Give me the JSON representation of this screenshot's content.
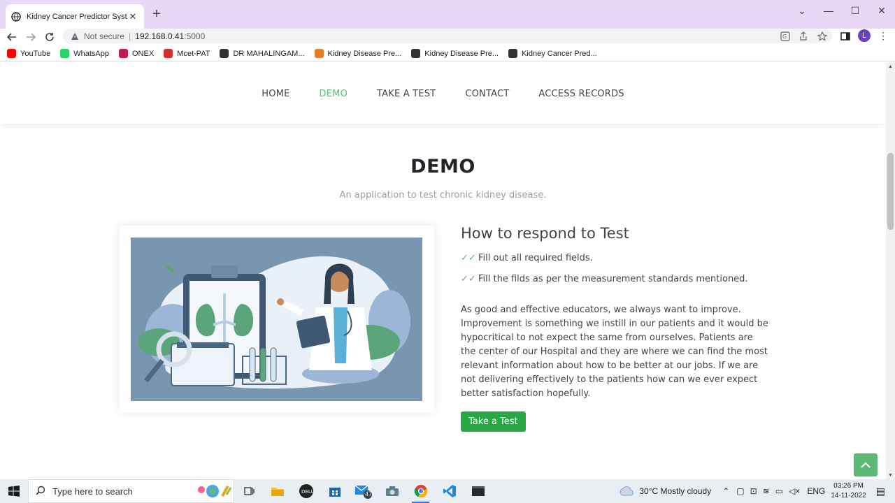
{
  "browser": {
    "tab_title": "Kidney Cancer Predictor System",
    "security_label": "Not secure",
    "url_host": "192.168.0.41",
    "url_port": ":5000",
    "profile_initial": "L",
    "bookmarks": [
      {
        "label": "YouTube",
        "color": "#ff0000"
      },
      {
        "label": "WhatsApp",
        "color": "#25d366"
      },
      {
        "label": "ONEX",
        "color": "#c2185b"
      },
      {
        "label": "Mcet-PAT",
        "color": "#d32f2f"
      },
      {
        "label": "DR MAHALINGAM...",
        "color": "#333333"
      },
      {
        "label": "Kidney Disease Pre...",
        "color": "#e67e22"
      },
      {
        "label": "Kidney Disease Pre...",
        "color": "#333333"
      },
      {
        "label": "Kidney Cancer Pred...",
        "color": "#333333"
      }
    ]
  },
  "site": {
    "nav": [
      "HOME",
      "DEMO",
      "TAKE A TEST",
      "CONTACT",
      "ACCESS RECORDS"
    ],
    "active_nav": "DEMO",
    "section_title": "DEMO",
    "section_subtitle": "An application to test chronic kidney disease.",
    "content_heading": "How to respond to Test",
    "checklist": [
      "Fill out all required fields.",
      "Fill the filds as per the measurement standards mentioned."
    ],
    "paragraph": "As good and effective educators, we always want to improve. Improvement is something we instill in our patients and it would be hypocritical to not expect the same from ourselves. Patients are the center of our Hospital and they are where we can find the most relevant information about how to be better at our jobs. If we are not delivering effectively to the patients how can we ever expect better satisfaction hopefully.",
    "cta_button": "Take a Test",
    "accent_color": "#5cb874",
    "button_color": "#28a745"
  },
  "taskbar": {
    "search_placeholder": "Type here to search",
    "mail_badge": "47",
    "weather": "30°C  Mostly cloudy",
    "language": "ENG",
    "time": "03:26 PM",
    "date": "14-11-2022"
  }
}
